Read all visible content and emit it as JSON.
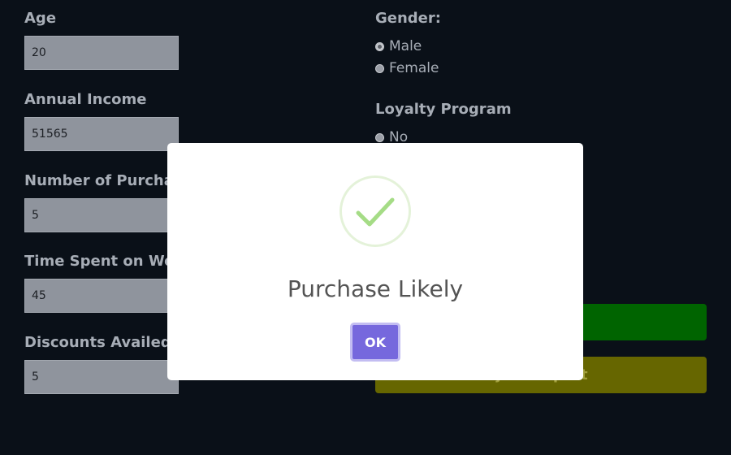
{
  "form": {
    "age": {
      "label": "Age",
      "value": "20"
    },
    "annual_income": {
      "label": "Annual Income",
      "value": "51565"
    },
    "number_of_purchases": {
      "label": "Number of Purchases",
      "value": "5"
    },
    "time_spent": {
      "label": "Time Spent on Website",
      "value": "45"
    },
    "discounts": {
      "label": "Discounts Availed",
      "value": "5"
    },
    "gender": {
      "label": "Gender:",
      "options": [
        "Male",
        "Female"
      ],
      "selected": "Male"
    },
    "loyalty": {
      "label": "Loyalty Program",
      "options": [
        "No"
      ]
    },
    "report_button": "Project Report"
  },
  "dialog": {
    "title": "Purchase Likely",
    "ok": "OK",
    "icon": "success-check-icon"
  },
  "colors": {
    "background": "#0a1018",
    "predict_button": "#006400",
    "report_button": "#666600",
    "ok_button": "#7668dd",
    "check": "#a5dc86"
  }
}
